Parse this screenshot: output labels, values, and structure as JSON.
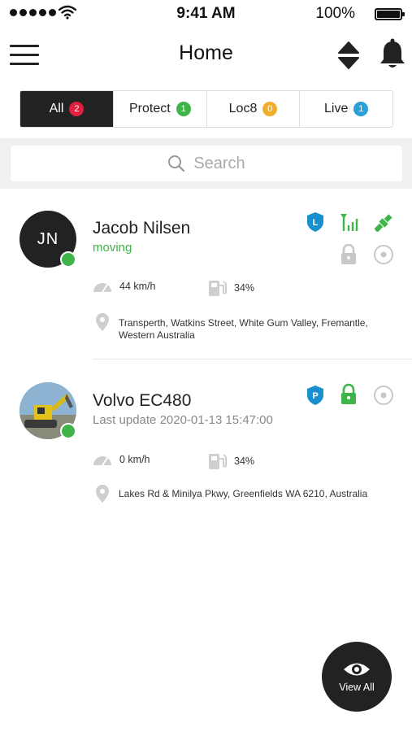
{
  "status_bar": {
    "time": "9:41 AM",
    "battery": "100%",
    "battery_level": 1.0
  },
  "nav": {
    "title": "Home",
    "icons": [
      "menu-icon",
      "sort-icon",
      "bell-icon"
    ]
  },
  "tabs": [
    {
      "label": "All",
      "count": "2",
      "color": "#e0203c",
      "active": true
    },
    {
      "label": "Protect",
      "count": "1",
      "color": "#3eb449",
      "active": false
    },
    {
      "label": "Loc8",
      "count": "0",
      "color": "#f0ad2e",
      "active": false
    },
    {
      "label": "Live",
      "count": "1",
      "color": "#2a9fd8",
      "active": false
    }
  ],
  "search": {
    "placeholder": "Search"
  },
  "assets": [
    {
      "initials": "JN",
      "name": "Jacob Nilsen",
      "status": "moving",
      "status_color": "#3eb449",
      "speed": "44 km/h",
      "fuel": "34%",
      "address_line1": "Transperth, Watkins Street, White Gum Valley, Fremantle,",
      "address_line2": "Western Australia",
      "icons": [
        "shield-l-icon",
        "signal-icon",
        "satellite-icon",
        "lock-icon",
        "target-icon"
      ]
    },
    {
      "name": "Volvo EC480",
      "status": "Last update 2020-01-13 15:47:00",
      "status_color": "#888888",
      "speed": "0 km/h",
      "fuel": "34%",
      "address_line1": "Lakes Rd & Minilya Pkwy, Greenfields WA 6210, Australia",
      "icons": [
        "shield-p-icon",
        "lock-icon",
        "target-icon"
      ]
    }
  ],
  "fab": {
    "label": "View All",
    "icon": "eye-icon"
  },
  "colors": {
    "accent_dark": "#222222",
    "green": "#3eb449",
    "blue": "#1a8fd0"
  }
}
